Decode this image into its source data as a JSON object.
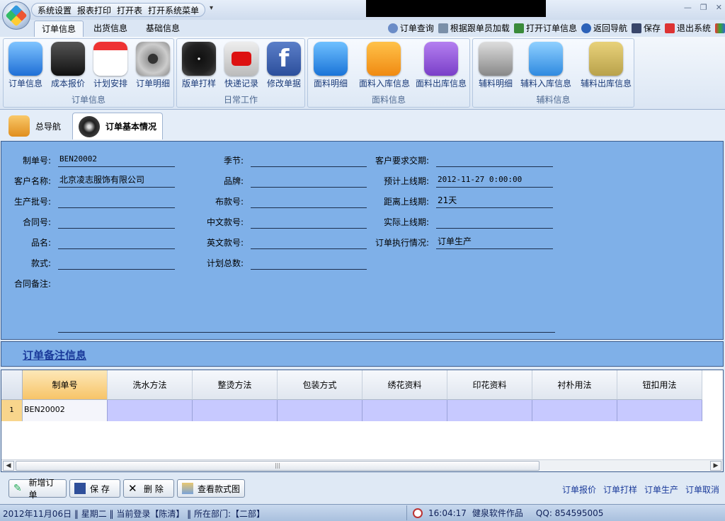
{
  "quick_access": [
    "系统设置",
    "报表打印",
    "打开表",
    "打开系统菜单"
  ],
  "ribbon_tabs": [
    "订单信息",
    "出货信息",
    "基础信息"
  ],
  "header_actions": [
    "订单查询",
    "根据跟单员加载",
    "打开订单信息",
    "返回导航",
    "保存",
    "退出系统"
  ],
  "ribbon_groups": [
    {
      "title": "订单信息",
      "buttons": [
        "订单信息",
        "成本报价",
        "计划安排",
        "订单明细"
      ]
    },
    {
      "title": "日常工作",
      "buttons": [
        "版单打样",
        "快递记录",
        "修改单据"
      ]
    },
    {
      "title": "面料信息",
      "buttons": [
        "面料明细",
        "面料入库信息",
        "面料出库信息"
      ]
    },
    {
      "title": "辅料信息",
      "buttons": [
        "辅料明细",
        "辅料入库信息",
        "辅料出库信息"
      ]
    }
  ],
  "doc_tabs": [
    "总导航",
    "订单基本情况"
  ],
  "form": {
    "labels": {
      "order_no": "制单号:",
      "customer": "客户名称:",
      "batch": "生产批号:",
      "contract": "合同号:",
      "product": "品名:",
      "style": "款式:",
      "contract_note": "合同备注:",
      "season": "季节:",
      "brand": "品牌:",
      "fabric_no": "布款号:",
      "cn_no": "中文款号:",
      "en_no": "英文款号:",
      "plan_total": "计划总数:",
      "req_date": "客户要求交期:",
      "plan_online": "预计上线期:",
      "days_to_online": "距离上线期:",
      "actual_online": "实际上线期:",
      "exec_status": "订单执行情况:"
    },
    "values": {
      "order_no": "BEN20002",
      "customer": "北京凌志服饰有限公司",
      "plan_online": "2012-11-27 0:00:00",
      "days_to_online": "21天",
      "exec_status": "订单生产"
    }
  },
  "notes_title": "订单备注信息",
  "grid": {
    "columns": [
      "制单号",
      "洗水方法",
      "整烫方法",
      "包装方式",
      "绣花资料",
      "印花资料",
      "衬朴用法",
      "钮扣用法"
    ],
    "rows": [
      {
        "num": "1",
        "order_no": "BEN20002"
      }
    ]
  },
  "bottom_buttons": [
    "新增订单",
    "保 存",
    "删 除",
    "查看款式图"
  ],
  "bottom_links": [
    "订单报价",
    "订单打样",
    "订单生产",
    "订单取消"
  ],
  "status": {
    "left": "2012年11月06日 ‖ 星期二 ‖ 当前登录【陈清】 ‖ 所在部门:【二部】",
    "time": "16:04:17",
    "company": "健泉软件作品",
    "qq": "QQ: 854595005"
  }
}
